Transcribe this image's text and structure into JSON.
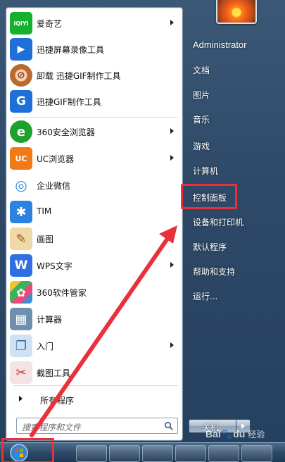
{
  "programs": [
    {
      "label": "爱奇艺",
      "icon": "iqiyi-icon",
      "color": "#15b12e",
      "glyph": "iQIYI",
      "has_submenu": true
    },
    {
      "label": "迅捷屏幕录像工具",
      "icon": "screen-recorder-icon",
      "color": "#1f6fd8",
      "glyph": "▶",
      "has_submenu": false
    },
    {
      "label": "卸载 迅捷GIF制作工具",
      "icon": "uninstall-icon",
      "color": "#b86a2f",
      "glyph": "⊘",
      "has_submenu": false
    },
    {
      "label": "迅捷GIF制作工具",
      "icon": "gif-maker-icon",
      "color": "#1f6fd8",
      "glyph": "G",
      "has_submenu": false
    },
    {
      "label": "360安全浏览器",
      "icon": "360-browser-icon",
      "color": "#1fa12b",
      "glyph": "e",
      "has_submenu": true
    },
    {
      "label": "UC浏览器",
      "icon": "uc-browser-icon",
      "color": "#f17a16",
      "glyph": "UC",
      "has_submenu": true
    },
    {
      "label": "企业微信",
      "icon": "wework-icon",
      "color": "#2e8bd8",
      "glyph": "◎",
      "has_submenu": false
    },
    {
      "label": "TIM",
      "icon": "tim-icon",
      "color": "#2c82e0",
      "glyph": "✱",
      "has_submenu": false
    },
    {
      "label": "画图",
      "icon": "paint-icon",
      "color": "#d49b3a",
      "glyph": "🎨",
      "has_submenu": false
    },
    {
      "label": "WPS文字",
      "icon": "wps-icon",
      "color": "#2f6fe0",
      "glyph": "W",
      "has_submenu": true
    },
    {
      "label": "360软件管家",
      "icon": "360-software-icon",
      "color": "#3ab35a",
      "glyph": "✿",
      "has_submenu": false
    },
    {
      "label": "计算器",
      "icon": "calculator-icon",
      "color": "#6f8fae",
      "glyph": "▦",
      "has_submenu": false
    },
    {
      "label": "入门",
      "icon": "getting-started-icon",
      "color": "#8fb5d8",
      "glyph": "❐",
      "has_submenu": true
    },
    {
      "label": "截图工具",
      "icon": "snipping-tool-icon",
      "color": "#c43a3a",
      "glyph": "✂",
      "has_submenu": false
    }
  ],
  "all_programs_label": "所有程序",
  "search_placeholder": "搜索程序和文件",
  "user_name": "Administrator",
  "right_items": [
    {
      "label": "文档"
    },
    {
      "label": "图片"
    },
    {
      "label": "音乐"
    },
    {
      "label": "游戏"
    },
    {
      "label": "计算机"
    },
    {
      "label": "控制面板"
    },
    {
      "label": "设备和打印机"
    },
    {
      "label": "默认程序"
    },
    {
      "label": "帮助和支持"
    },
    {
      "label": "运行..."
    }
  ],
  "shutdown_label": "关机",
  "watermark": {
    "text": "Bai",
    "paw": "du",
    "sub": "经验"
  },
  "colors": {
    "highlight": "#e8313b",
    "panel_bg": "#ffffff",
    "right_bg": "#2e4a68"
  }
}
